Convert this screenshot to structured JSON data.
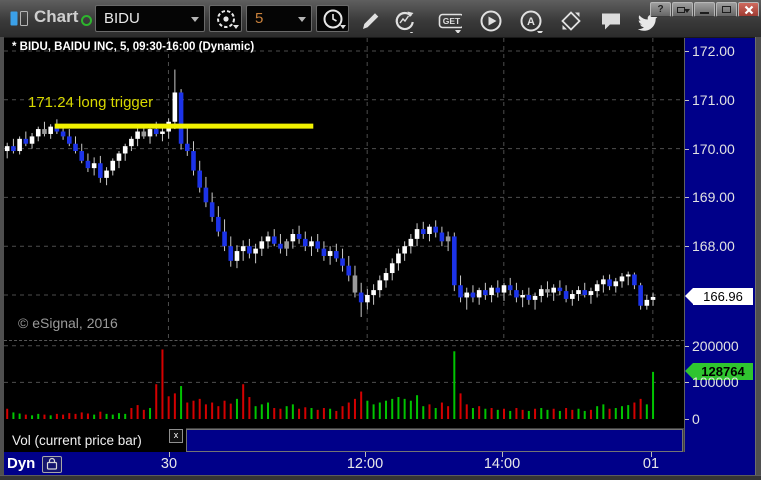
{
  "toolbar": {
    "app_label": "Chart",
    "symbol_value": "BIDU",
    "interval_value": "5",
    "get_label": "GET",
    "circled_a_label": "A"
  },
  "window_controls": {
    "help_label": "?"
  },
  "vol_pane": {
    "tab_label": "Vol (current price bar)",
    "close_label": "x"
  },
  "status_bar": {
    "mode_label": "Dyn",
    "time_labels": [
      "30",
      "12:00",
      "14:00",
      "01"
    ]
  },
  "watermark": "© eSignal, 2016",
  "chart_data": {
    "type": "candlestick",
    "symbol": "BIDU",
    "interval": "5",
    "title": "* BIDU, BAIDU INC, 5, 09:30-16:00 (Dynamic)",
    "price_ticks": [
      172,
      171,
      170,
      169,
      168,
      167
    ],
    "ylim": [
      166.1,
      172.27
    ],
    "last_price": "166.96",
    "volume_ticks": [
      200000,
      100000,
      0
    ],
    "last_volume": "128764",
    "time_gridline_bars": [
      26,
      58,
      80,
      104
    ],
    "annotation": {
      "text": "171.24 long trigger",
      "price": 170.46,
      "from_bar": 8,
      "to_bar": 49
    },
    "up_color": "#ffffff",
    "down_color": "#1c33e8",
    "neutral_color": "#9a9a9a",
    "wick_color": "#c8c8c8",
    "vol_up_color": "#00c400",
    "vol_down_color": "#d40000",
    "grid_color": "#4d4d4d",
    "annotation_color": "#f2f200",
    "candles": [
      [
        169.95,
        170.12,
        169.8,
        170.05
      ],
      [
        170.05,
        170.2,
        169.9,
        169.95
      ],
      [
        169.95,
        170.25,
        169.88,
        170.2
      ],
      [
        170.2,
        170.35,
        170.05,
        170.1
      ],
      [
        170.1,
        170.32,
        170.0,
        170.25
      ],
      [
        170.25,
        170.45,
        170.15,
        170.4
      ],
      [
        170.4,
        170.55,
        170.25,
        170.3,
        "gray"
      ],
      [
        170.3,
        170.5,
        170.2,
        170.45
      ],
      [
        170.45,
        170.6,
        170.3,
        170.35
      ],
      [
        170.35,
        170.5,
        170.18,
        170.25
      ],
      [
        170.25,
        170.4,
        170.05,
        170.1
      ],
      [
        170.1,
        170.25,
        169.9,
        169.95
      ],
      [
        169.95,
        170.1,
        169.7,
        169.75
      ],
      [
        169.75,
        169.9,
        169.52,
        169.6
      ],
      [
        169.6,
        169.82,
        169.45,
        169.7
      ],
      [
        169.7,
        169.85,
        169.3,
        169.4
      ],
      [
        169.4,
        169.62,
        169.25,
        169.55
      ],
      [
        169.55,
        169.8,
        169.45,
        169.75
      ],
      [
        169.75,
        169.95,
        169.6,
        169.9
      ],
      [
        169.9,
        170.1,
        169.75,
        170.05
      ],
      [
        170.05,
        170.25,
        169.95,
        170.2
      ],
      [
        170.2,
        170.42,
        170.05,
        170.35
      ],
      [
        170.35,
        170.5,
        170.2,
        170.25,
        "gray"
      ],
      [
        170.25,
        170.45,
        170.1,
        170.4
      ],
      [
        170.4,
        170.55,
        170.25,
        170.3
      ],
      [
        170.3,
        170.48,
        170.15,
        170.35
      ],
      [
        170.35,
        170.62,
        170.2,
        170.55
      ],
      [
        170.55,
        171.62,
        170.4,
        171.15
      ],
      [
        171.15,
        171.22,
        169.98,
        170.1
      ],
      [
        170.1,
        170.45,
        169.85,
        169.95
      ],
      [
        169.95,
        170.15,
        169.45,
        169.55
      ],
      [
        169.55,
        169.75,
        169.1,
        169.2
      ],
      [
        169.2,
        169.42,
        168.8,
        168.9
      ],
      [
        168.9,
        169.1,
        168.5,
        168.6
      ],
      [
        168.6,
        168.82,
        168.2,
        168.3
      ],
      [
        168.3,
        168.55,
        167.9,
        168.0
      ],
      [
        168.0,
        168.2,
        167.58,
        167.7
      ],
      [
        167.7,
        168.02,
        167.55,
        167.9
      ],
      [
        167.9,
        168.12,
        167.7,
        168.0
      ],
      [
        168.0,
        168.15,
        167.75,
        167.85
      ],
      [
        167.85,
        168.05,
        167.65,
        167.95
      ],
      [
        167.95,
        168.2,
        167.8,
        168.1
      ],
      [
        168.1,
        168.3,
        167.95,
        168.2
      ],
      [
        168.2,
        168.35,
        168.0,
        168.05
      ],
      [
        168.05,
        168.25,
        167.85,
        167.95
      ],
      [
        167.95,
        168.15,
        167.8,
        168.1,
        "gray"
      ],
      [
        168.1,
        168.35,
        167.95,
        168.25
      ],
      [
        168.25,
        168.42,
        168.05,
        168.15
      ],
      [
        168.15,
        168.3,
        167.9,
        168.0
      ],
      [
        168.0,
        168.2,
        167.8,
        168.1
      ],
      [
        168.1,
        168.25,
        167.88,
        167.95
      ],
      [
        167.95,
        168.1,
        167.7,
        167.8
      ],
      [
        167.8,
        168.0,
        167.62,
        167.9
      ],
      [
        167.9,
        168.05,
        167.68,
        167.75
      ],
      [
        167.75,
        167.95,
        167.48,
        167.6
      ],
      [
        167.6,
        167.8,
        167.28,
        167.4
      ],
      [
        167.4,
        167.6,
        166.95,
        167.05,
        "gray"
      ],
      [
        167.05,
        167.25,
        166.55,
        166.85
      ],
      [
        166.85,
        167.12,
        166.7,
        167.0
      ],
      [
        167.0,
        167.22,
        166.8,
        167.1
      ],
      [
        167.1,
        167.4,
        166.95,
        167.3
      ],
      [
        167.3,
        167.55,
        167.15,
        167.45
      ],
      [
        167.45,
        167.75,
        167.3,
        167.65
      ],
      [
        167.65,
        167.95,
        167.5,
        167.85
      ],
      [
        167.85,
        168.1,
        167.7,
        168.0
      ],
      [
        168.0,
        168.25,
        167.85,
        168.15
      ],
      [
        168.15,
        168.47,
        168.0,
        168.35
      ],
      [
        168.35,
        168.5,
        168.15,
        168.25
      ],
      [
        168.25,
        168.45,
        168.1,
        168.4
      ],
      [
        168.4,
        168.53,
        168.18,
        168.28
      ],
      [
        168.28,
        168.4,
        168.0,
        168.1
      ],
      [
        168.1,
        168.3,
        167.9,
        168.2,
        "gray"
      ],
      [
        168.2,
        168.28,
        167.08,
        167.2
      ],
      [
        167.2,
        167.4,
        166.85,
        166.95
      ],
      [
        166.95,
        167.15,
        166.7,
        167.05
      ],
      [
        167.05,
        167.2,
        166.85,
        166.95
      ],
      [
        166.95,
        167.15,
        166.8,
        167.1
      ],
      [
        167.1,
        167.25,
        166.9,
        167.0
      ],
      [
        167.0,
        167.2,
        166.85,
        167.15
      ],
      [
        167.15,
        167.3,
        166.95,
        167.05
      ],
      [
        167.05,
        167.25,
        166.88,
        167.2
      ],
      [
        167.2,
        167.35,
        167.0,
        167.1
      ],
      [
        167.1,
        167.25,
        166.85,
        166.95
      ],
      [
        166.95,
        167.1,
        166.75,
        167.0
      ],
      [
        167.0,
        167.15,
        166.8,
        166.9
      ],
      [
        166.9,
        167.05,
        166.7,
        166.98
      ],
      [
        166.98,
        167.2,
        166.85,
        167.12
      ],
      [
        167.12,
        167.28,
        166.95,
        167.05,
        "gray"
      ],
      [
        167.05,
        167.22,
        166.88,
        167.15
      ],
      [
        167.15,
        167.3,
        167.0,
        167.08
      ],
      [
        167.08,
        167.2,
        166.85,
        166.92
      ],
      [
        166.92,
        167.1,
        166.78,
        167.02
      ],
      [
        167.02,
        167.18,
        166.88,
        167.1
      ],
      [
        167.1,
        167.25,
        166.95,
        167.0
      ],
      [
        167.0,
        167.15,
        166.82,
        167.08
      ],
      [
        167.08,
        167.3,
        166.95,
        167.22
      ],
      [
        167.22,
        167.4,
        167.05,
        167.32
      ],
      [
        167.32,
        167.42,
        167.1,
        167.18
      ],
      [
        167.18,
        167.35,
        167.05,
        167.28
      ],
      [
        167.28,
        167.45,
        167.15,
        167.38
      ],
      [
        167.38,
        167.48,
        167.2,
        167.42
      ],
      [
        167.42,
        167.46,
        167.12,
        167.2
      ],
      [
        167.2,
        167.25,
        166.7,
        166.78
      ],
      [
        166.78,
        167.0,
        166.7,
        166.9
      ],
      [
        166.9,
        167.05,
        166.78,
        166.96
      ]
    ],
    "volumes": [
      28000,
      18000,
      15000,
      12000,
      10000,
      14000,
      12000,
      10000,
      14000,
      12000,
      16000,
      14000,
      18000,
      15000,
      12000,
      20000,
      14000,
      12000,
      16000,
      14000,
      30000,
      38000,
      25000,
      30000,
      95000,
      190000,
      62000,
      70000,
      90000,
      45000,
      50000,
      55000,
      40000,
      45000,
      35000,
      50000,
      42000,
      55000,
      95000,
      60000,
      35000,
      40000,
      45000,
      30000,
      28000,
      35000,
      40000,
      28000,
      32000,
      30000,
      25000,
      30000,
      28000,
      22000,
      35000,
      45000,
      55000,
      75000,
      50000,
      40000,
      45000,
      50000,
      55000,
      60000,
      55000,
      50000,
      65000,
      35000,
      40000,
      30000,
      45000,
      35000,
      185000,
      70000,
      40000,
      30000,
      35000,
      28000,
      30000,
      25000,
      28000,
      22000,
      30000,
      25000,
      22000,
      28000,
      30000,
      25000,
      28000,
      22000,
      30000,
      25000,
      28000,
      22000,
      25000,
      35000,
      40000,
      28000,
      30000,
      35000,
      38000,
      45000,
      55000,
      40000,
      128764
    ],
    "volume_color_seq": "rggrggrgrrrrrrgrggggrrrgrrrrgrrrrrrrrgrrgggrrggrrgrrgrrrrrggggggggggrgrrgrrgrgrgrgrrgrggrgrrggrggrgggrrgg"
  }
}
